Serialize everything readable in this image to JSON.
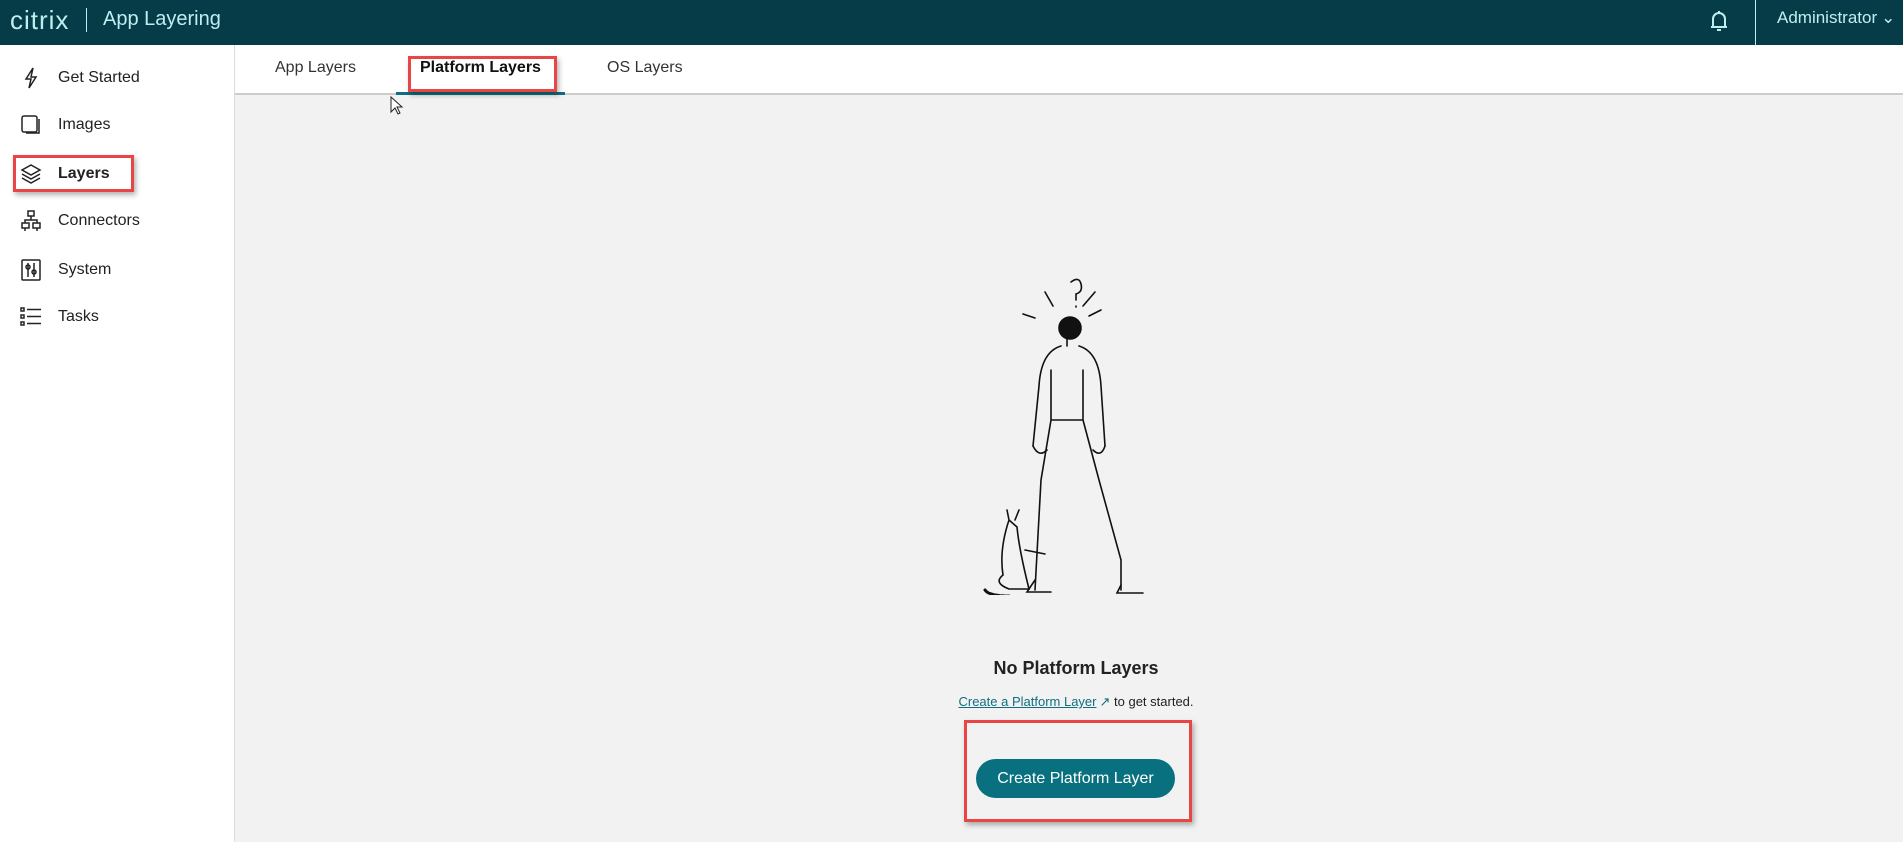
{
  "header": {
    "logo": "citrix",
    "app_title": "App Layering",
    "user": "Administrator"
  },
  "sidebar": {
    "items": [
      {
        "label": "Get Started",
        "icon": "lightning-icon"
      },
      {
        "label": "Images",
        "icon": "images-icon"
      },
      {
        "label": "Layers",
        "icon": "layers-icon"
      },
      {
        "label": "Connectors",
        "icon": "connectors-icon"
      },
      {
        "label": "System",
        "icon": "system-icon"
      },
      {
        "label": "Tasks",
        "icon": "tasks-icon"
      }
    ]
  },
  "tabs": [
    {
      "label": "App Layers"
    },
    {
      "label": "Platform Layers",
      "active": true
    },
    {
      "label": "OS Layers"
    }
  ],
  "empty_state": {
    "title": "No Platform Layers",
    "link": "Create a Platform Layer",
    "suffix": " to get started.",
    "button": "Create Platform Layer"
  },
  "colors": {
    "header": "#053c48",
    "accent": "#08707f",
    "highlight": "#e84545"
  }
}
